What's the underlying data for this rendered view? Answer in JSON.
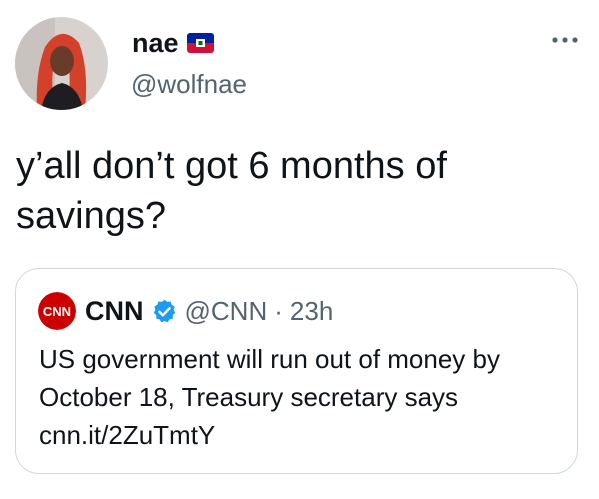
{
  "user": {
    "display_name": "nae",
    "handle": "@wolfnae",
    "flag_icon": "haiti-flag-icon",
    "avatar_icon": "profile-photo-avatar"
  },
  "tweet": {
    "text": "y’all don’t got 6 months of savings?"
  },
  "quote": {
    "logo_text": "CNN",
    "name": "CNN",
    "handle": "@CNN",
    "separator": "·",
    "time": "23h",
    "text_line1": "US government will run out of money by",
    "text_line2": "October 18, Treasury secretary says",
    "link": "cnn.it/2ZuTmtY",
    "verified_icon": "verified-badge-icon"
  },
  "colors": {
    "primary_text": "#0f1419",
    "secondary_text": "#536471",
    "verified_blue": "#1d9bf0",
    "cnn_red": "#cc0000",
    "border": "#cfd9de"
  }
}
